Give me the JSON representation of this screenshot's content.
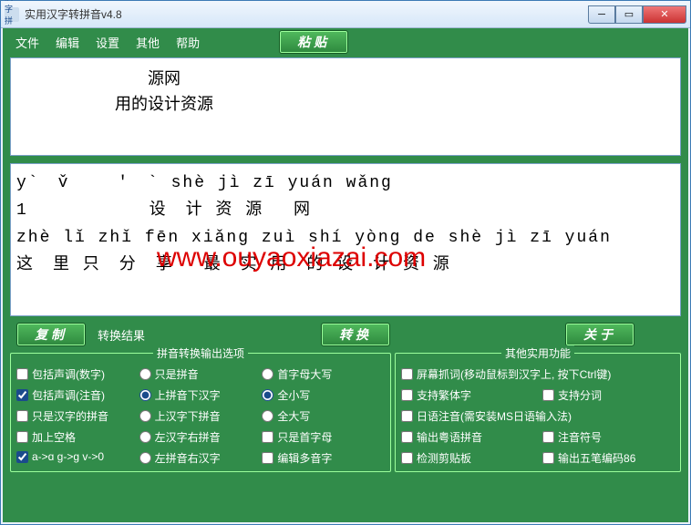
{
  "window": {
    "title": "实用汉字转拼音v4.8",
    "icon_text": "汉字拼音"
  },
  "menu": {
    "file": "文件",
    "edit": "编辑",
    "settings": "设置",
    "other": "其他",
    "help": "帮助",
    "paste_btn": "粘贴"
  },
  "input": {
    "line1": "　　　　　　　　源网",
    "line2": "　　　　　　用的设计资源"
  },
  "output": {
    "line1": "y`　v̌　　 ′　` shè jì zī yuán wǎng",
    "line2": "1　　　　　　 设　计 资 源　 网",
    "line3": "zhè lǐ zhǐ fēn xiǎnɡ zuì shí yònɡ de shè jì zī yuán",
    "line4": "这　里 只　分　享　 最　实 用　的 设　计 资 源"
  },
  "watermark": "www.ouyaoxiazai.com",
  "actions": {
    "copy": "复制",
    "result_lbl": "转换结果",
    "convert": "转换",
    "about": "关于"
  },
  "groups": {
    "left_title": "拼音转换输出选项",
    "right_title": "其他实用功能"
  },
  "opts": {
    "col1": {
      "a": "包括声调(数字)",
      "b": "包括声调(注音)",
      "c": "只是汉字的拼音",
      "d": "加上空格",
      "e": "a->ɑ g->ɡ v->0"
    },
    "col2": {
      "a": "只是拼音",
      "b": "上拼音下汉字",
      "c": "上汉字下拼音",
      "d": "左汉字右拼音",
      "e": "左拼音右汉字"
    },
    "col3": {
      "a": "首字母大写",
      "b": "全小写",
      "c": "全大写",
      "d": "只是首字母",
      "e": "编辑多音字"
    }
  },
  "other": {
    "a": "屏幕抓词(移动鼠标到汉字上, 按下Ctrl键)",
    "b": "支持繁体字",
    "b2": "支持分词",
    "c": "日语注音(需安装MS日语输入法)",
    "d": "输出粤语拼音",
    "d2": "注音符号",
    "e": "检测剪贴板",
    "e2": "输出五笔编码86"
  }
}
